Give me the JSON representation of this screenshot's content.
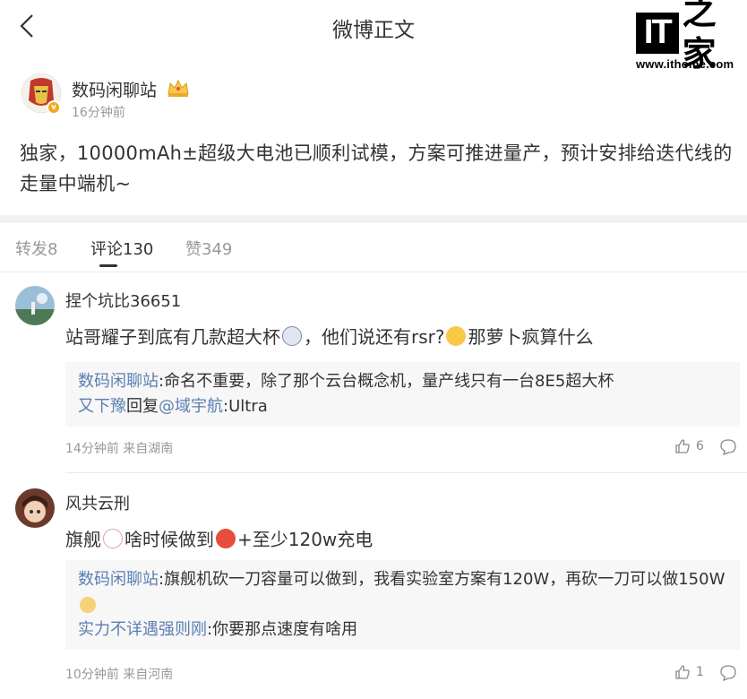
{
  "nav": {
    "title": "微博正文"
  },
  "logo": {
    "brand": "IT之家",
    "url": "www.ithome.com"
  },
  "post": {
    "author": "数码闲聊站",
    "time": "16分钟前",
    "text": "独家，10000mAh±超级大电池已顺利试模，方案可推进量产，预计安排给迭代线的走量中端机~"
  },
  "tabs": [
    {
      "label": "转发8"
    },
    {
      "label": "评论130"
    },
    {
      "label": "赞349"
    }
  ],
  "comments": [
    {
      "name": "捏个坑比36651",
      "text_a": "站哥耀子到底有几款超大杯",
      "text_b": "，他们说还有rsr?",
      "text_c": "那萝卜疯算什么",
      "replies": [
        {
          "name": "数码闲聊站",
          "text": ":命名不重要，除了那个云台概念机，量产线只有一台8E5超大杯"
        },
        {
          "name": "又下豫",
          "mid": "回复",
          "at": "@域宇航",
          "text": ":Ultra"
        }
      ],
      "meta": "14分钟前 来自湖南",
      "likes": "6"
    },
    {
      "name": "风共云刑",
      "text_a": "旗舰",
      "text_b": "啥时候做到",
      "text_c": "+至少120w充电",
      "replies": [
        {
          "name": "数码闲聊站",
          "text": ":旗舰机砍一刀容量可以做到，我看实验室方案有120W，再砍一刀可以做150W"
        },
        {
          "name": "实力不详遇强则刚",
          "text": ":你要那点速度有啥用"
        }
      ],
      "meta": "10分钟前 来自河南",
      "likes": "1"
    }
  ]
}
